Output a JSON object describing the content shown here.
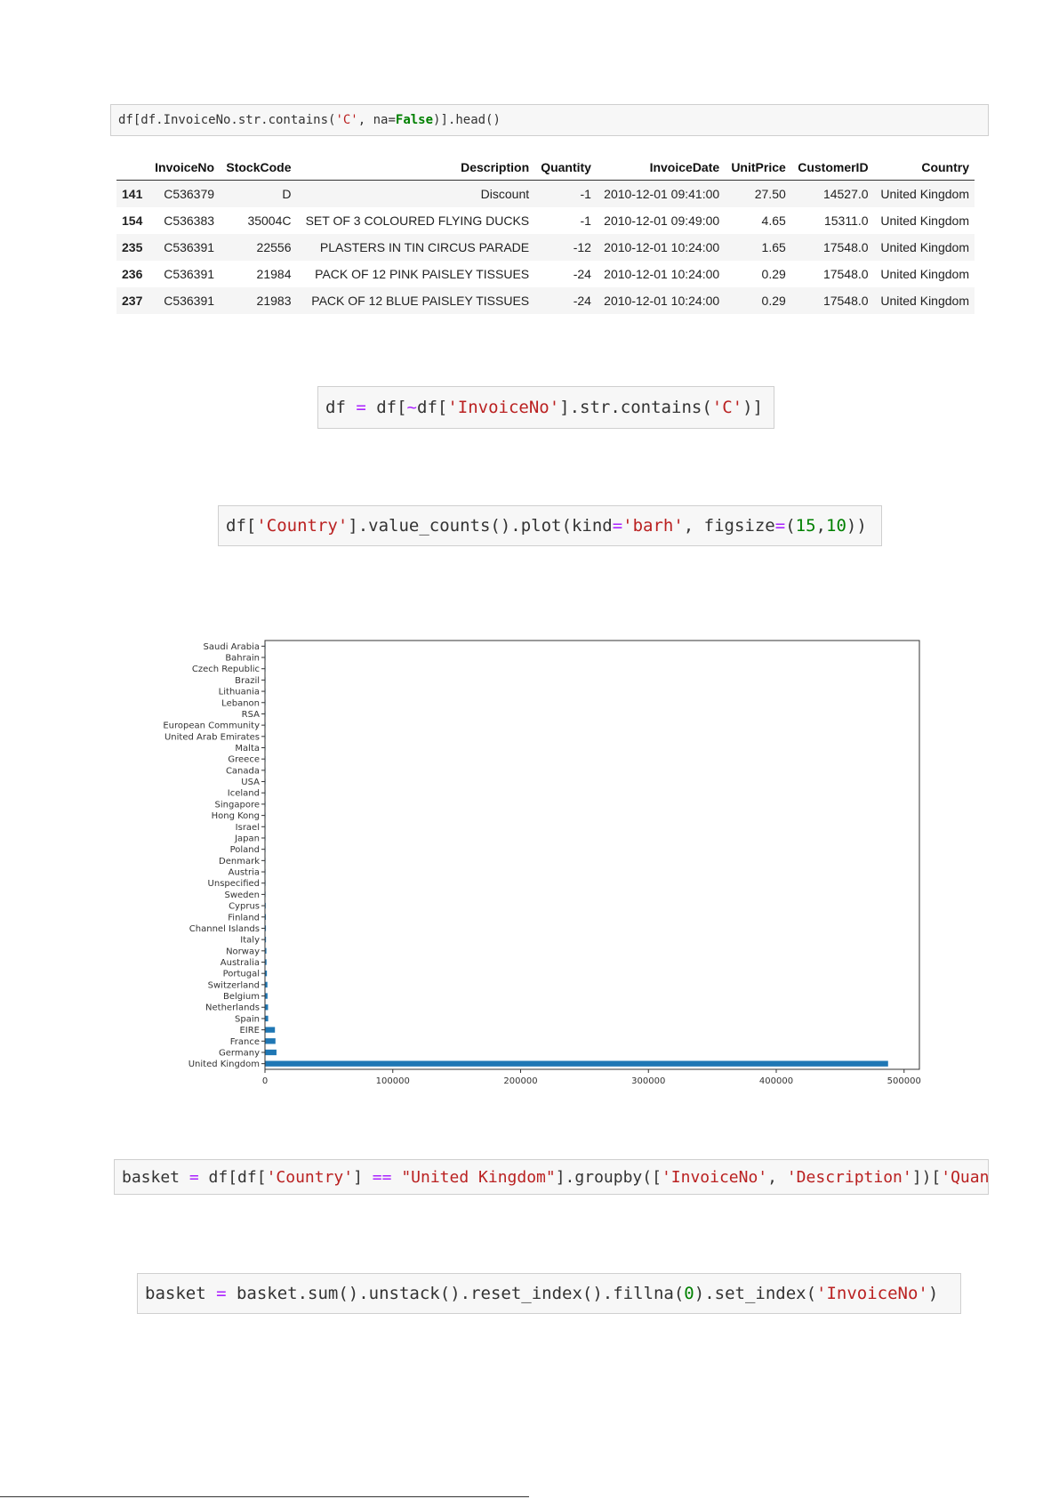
{
  "cell1": {
    "segments": [
      {
        "t": "df[df.InvoiceNo.str.contains(",
        "c": ""
      },
      {
        "t": "'C'",
        "c": "str"
      },
      {
        "t": ", na=",
        "c": ""
      },
      {
        "t": "False",
        "c": "kw"
      },
      {
        "t": ")].head()",
        "c": ""
      }
    ]
  },
  "table": {
    "columns": [
      "",
      "InvoiceNo",
      "StockCode",
      "Description",
      "Quantity",
      "InvoiceDate",
      "UnitPrice",
      "CustomerID",
      "Country"
    ],
    "rows": [
      [
        "141",
        "C536379",
        "D",
        "Discount",
        "-1",
        "2010-12-01 09:41:00",
        "27.50",
        "14527.0",
        "United Kingdom"
      ],
      [
        "154",
        "C536383",
        "35004C",
        "SET OF 3 COLOURED FLYING DUCKS",
        "-1",
        "2010-12-01 09:49:00",
        "4.65",
        "15311.0",
        "United Kingdom"
      ],
      [
        "235",
        "C536391",
        "22556",
        "PLASTERS IN TIN CIRCUS PARADE",
        "-12",
        "2010-12-01 10:24:00",
        "1.65",
        "17548.0",
        "United Kingdom"
      ],
      [
        "236",
        "C536391",
        "21984",
        "PACK OF 12 PINK PAISLEY TISSUES",
        "-24",
        "2010-12-01 10:24:00",
        "0.29",
        "17548.0",
        "United Kingdom"
      ],
      [
        "237",
        "C536391",
        "21983",
        "PACK OF 12 BLUE PAISLEY TISSUES",
        "-24",
        "2010-12-01 10:24:00",
        "0.29",
        "17548.0",
        "United Kingdom"
      ]
    ]
  },
  "cell2": {
    "segments": [
      {
        "t": "df ",
        "c": ""
      },
      {
        "t": "=",
        "c": "op"
      },
      {
        "t": " df[",
        "c": ""
      },
      {
        "t": "~",
        "c": "op"
      },
      {
        "t": "df[",
        "c": ""
      },
      {
        "t": "'InvoiceNo'",
        "c": "str"
      },
      {
        "t": "].str.contains(",
        "c": ""
      },
      {
        "t": "'C'",
        "c": "str"
      },
      {
        "t": ")]",
        "c": ""
      }
    ]
  },
  "cell3": {
    "segments": [
      {
        "t": "df[",
        "c": ""
      },
      {
        "t": "'Country'",
        "c": "str"
      },
      {
        "t": "].value_counts().plot(kind",
        "c": ""
      },
      {
        "t": "=",
        "c": "op"
      },
      {
        "t": "'barh'",
        "c": "str"
      },
      {
        "t": ", figsize",
        "c": ""
      },
      {
        "t": "=",
        "c": "op"
      },
      {
        "t": "(",
        "c": ""
      },
      {
        "t": "15",
        "c": "num"
      },
      {
        "t": ",",
        "c": ""
      },
      {
        "t": "10",
        "c": "num"
      },
      {
        "t": "))",
        "c": ""
      }
    ]
  },
  "chart_data": {
    "type": "bar",
    "orientation": "horizontal",
    "categories": [
      "United Kingdom",
      "Germany",
      "France",
      "EIRE",
      "Spain",
      "Netherlands",
      "Belgium",
      "Switzerland",
      "Portugal",
      "Australia",
      "Norway",
      "Italy",
      "Channel Islands",
      "Finland",
      "Cyprus",
      "Sweden",
      "Unspecified",
      "Austria",
      "Denmark",
      "Poland",
      "Japan",
      "Israel",
      "Hong Kong",
      "Singapore",
      "Iceland",
      "USA",
      "Canada",
      "Greece",
      "Malta",
      "United Arab Emirates",
      "European Community",
      "RSA",
      "Lebanon",
      "Lithuania",
      "Brazil",
      "Czech Republic",
      "Bahrain",
      "Saudi Arabia"
    ],
    "values": [
      487500,
      9000,
      8200,
      7800,
      2500,
      2400,
      2000,
      1900,
      1500,
      1200,
      1100,
      800,
      750,
      700,
      600,
      450,
      450,
      400,
      400,
      340,
      330,
      290,
      280,
      230,
      180,
      180,
      150,
      145,
      125,
      70,
      60,
      55,
      45,
      35,
      30,
      25,
      15,
      10
    ],
    "xticks": [
      0,
      100000,
      200000,
      300000,
      400000,
      500000
    ],
    "xlim": [
      0,
      512000
    ],
    "color": "#1f77b4",
    "grid": false
  },
  "cell4": {
    "segments": [
      {
        "t": "basket ",
        "c": ""
      },
      {
        "t": "=",
        "c": "op"
      },
      {
        "t": " df[df[",
        "c": ""
      },
      {
        "t": "'Country'",
        "c": "str"
      },
      {
        "t": "] ",
        "c": ""
      },
      {
        "t": "==",
        "c": "op"
      },
      {
        "t": " ",
        "c": ""
      },
      {
        "t": "\"United Kingdom\"",
        "c": "str"
      },
      {
        "t": "].groupby([",
        "c": ""
      },
      {
        "t": "'InvoiceNo'",
        "c": "str"
      },
      {
        "t": ", ",
        "c": ""
      },
      {
        "t": "'Description'",
        "c": "str"
      },
      {
        "t": "])[",
        "c": ""
      },
      {
        "t": "'Quantity'",
        "c": "str"
      },
      {
        "t": "]",
        "c": ""
      }
    ]
  },
  "cell5": {
    "segments": [
      {
        "t": "basket ",
        "c": ""
      },
      {
        "t": "=",
        "c": "op"
      },
      {
        "t": " basket.sum().unstack().reset_index().fillna(",
        "c": ""
      },
      {
        "t": "0",
        "c": "num"
      },
      {
        "t": ").set_index(",
        "c": ""
      },
      {
        "t": "'InvoiceNo'",
        "c": "str"
      },
      {
        "t": ")",
        "c": ""
      }
    ]
  }
}
